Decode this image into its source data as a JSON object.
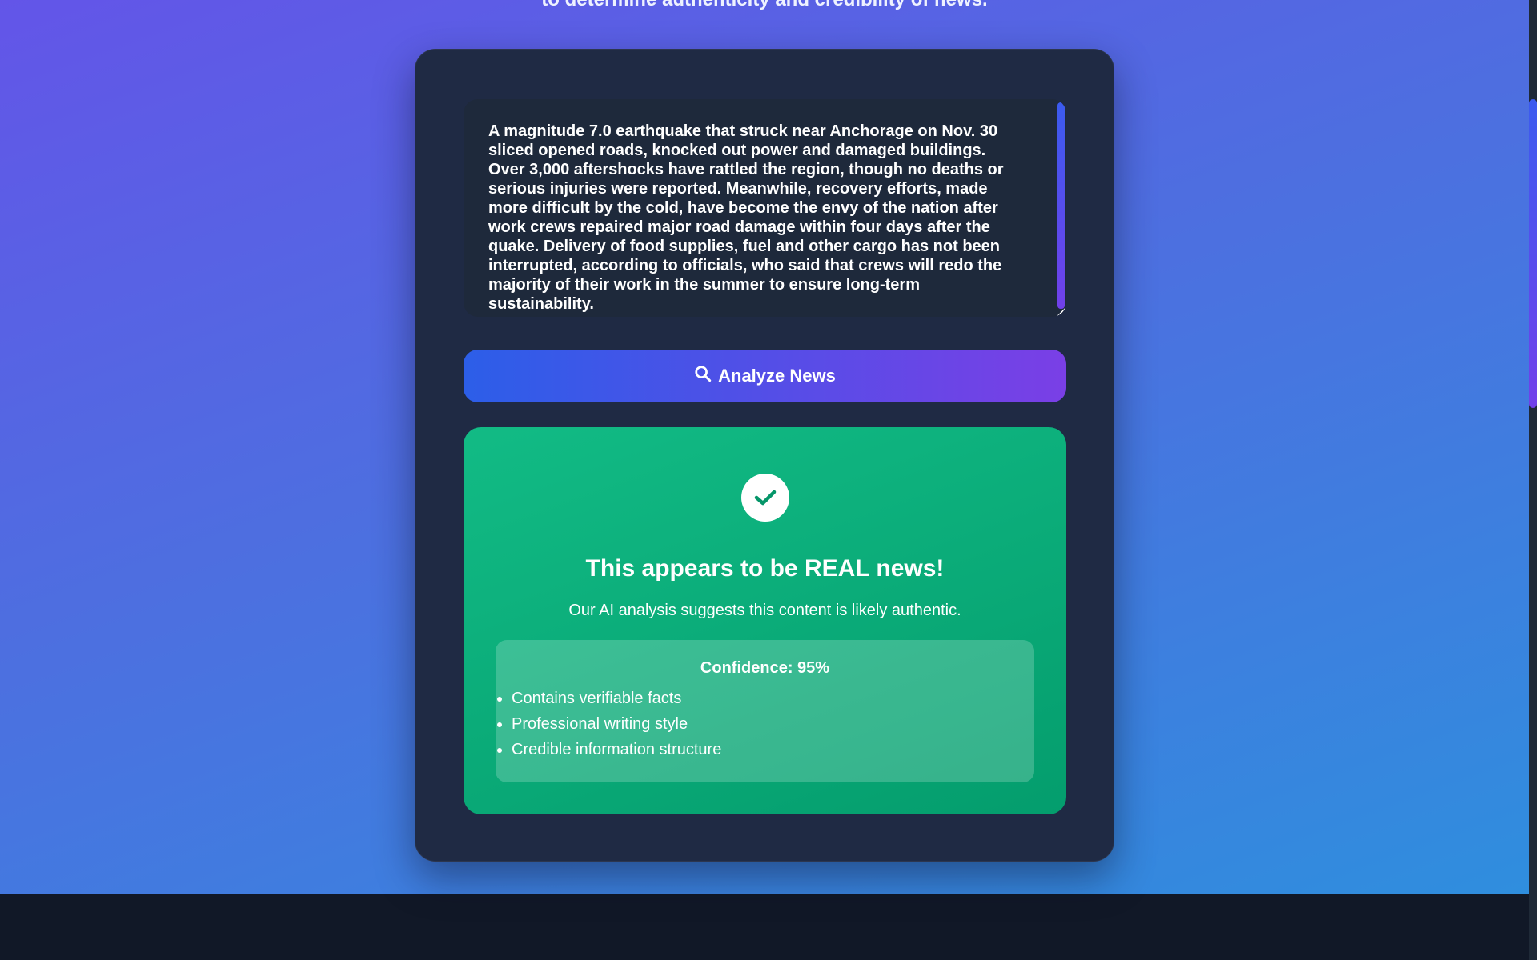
{
  "header": {
    "subtitle": "to determine authenticity and credibility of news."
  },
  "input": {
    "news_text": "A magnitude 7.0 earthquake that struck near Anchorage on Nov. 30 sliced opened roads, knocked out power and damaged buildings. Over 3,000 aftershocks have rattled the region, though no deaths or serious injuries were reported. Meanwhile, recovery efforts, made more difficult by the cold, have become the envy of the nation after work crews repaired major road damage within four days after the quake. Delivery of food supplies, fuel and other cargo has not been interrupted, according to officials, who said that crews will redo the majority of their work in the summer to ensure long-term sustainability."
  },
  "analyze_button": {
    "label": "Analyze News",
    "icon": "search-icon"
  },
  "result": {
    "icon": "check-icon",
    "title": "This appears to be REAL news!",
    "description": "Our AI analysis suggests this content is likely authentic.",
    "confidence_label": "Confidence: 95%",
    "confidence_value": 95,
    "reasons": [
      "Contains verifiable facts",
      "Professional writing style",
      "Credible information structure"
    ]
  },
  "colors": {
    "result_green": "#10b981",
    "button_start": "#2c5ee8",
    "button_end": "#7a3fe6",
    "card_bg": "#1f2a44"
  }
}
